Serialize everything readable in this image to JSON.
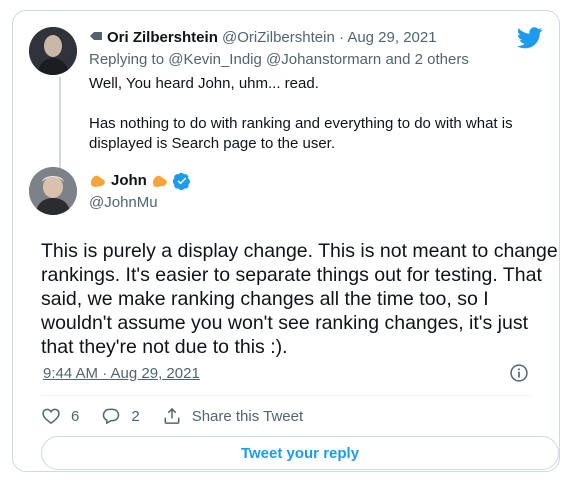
{
  "parent_tweet": {
    "display_name": "Ori Zilbershtein",
    "handle": "@OriZilbershtein",
    "date": "Aug 29, 2021",
    "separator": "·",
    "replying_to": "Replying to @Kevin_Indig @Johanstormarn and 2 others",
    "paragraphs": [
      "Well, You heard John, uhm... read.",
      "Has nothing to do with ranking and everything to do with what is displayed is Search page to the user."
    ]
  },
  "main_tweet": {
    "display_name": "John",
    "handle": "@JohnMu",
    "text": "This is purely a display change. This is not meant to change rankings. It's easier to separate things out for testing. That said, we make ranking changes all the time too, so I wouldn't assume you won't see ranking changes, it's just that they're not due to this :).",
    "timestamp": "9:44 AM · Aug 29, 2021"
  },
  "actions": {
    "likes": "6",
    "replies": "2",
    "share_label": "Share this Tweet"
  },
  "reply_button_label": "Tweet your reply",
  "icons": [
    "twitter-bird-icon",
    "clap-icon",
    "verified-badge-icon",
    "info-icon",
    "heart-icon",
    "comment-icon",
    "share-icon"
  ],
  "colors": {
    "accent": "#1d9bf0",
    "muted": "#536471",
    "clap": "#f7a43b"
  }
}
